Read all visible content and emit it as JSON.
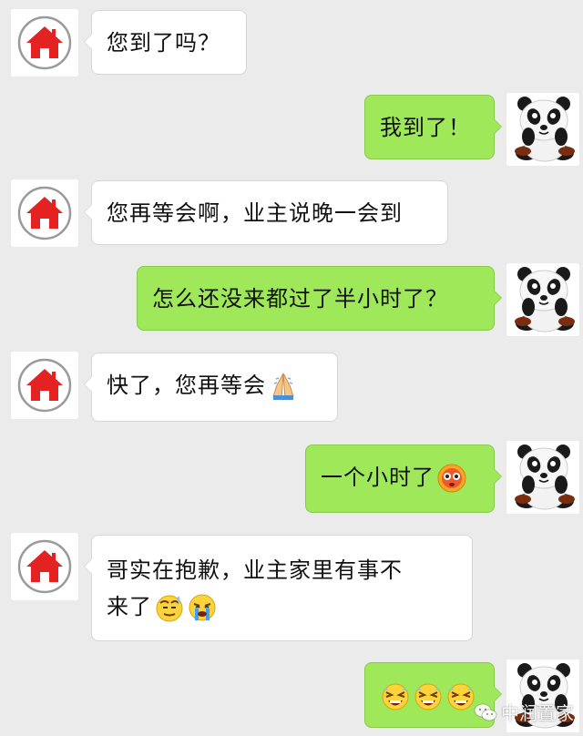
{
  "messages": [
    {
      "side": "in",
      "text": "您到了吗？"
    },
    {
      "side": "out",
      "text": "我到了！"
    },
    {
      "side": "in",
      "text": "您再等会啊，业主说晚一会到"
    },
    {
      "side": "out",
      "text": "怎么还没来都过了半小时了？"
    },
    {
      "side": "in",
      "text": "快了，您再等会",
      "emoji": [
        "folded-hands-emoji"
      ]
    },
    {
      "side": "out",
      "text": "一个小时了",
      "emoji": [
        "flushed-face-emoji"
      ]
    },
    {
      "side": "in",
      "text_line1": "哥实在抱歉，业主家里有事不",
      "text_line2": "来了",
      "emoji": [
        "sweat-face-emoji",
        "crying-face-emoji"
      ]
    },
    {
      "side": "out",
      "text": "",
      "emoji": [
        "tired-face-emoji",
        "tired-face-emoji",
        "tired-face-emoji"
      ]
    }
  ],
  "watermark": {
    "text": "中润置家"
  },
  "colors": {
    "background": "#ebebeb",
    "incoming_bubble": "#ffffff",
    "outgoing_bubble": "#9fe85a",
    "house_icon": "#e52222"
  }
}
